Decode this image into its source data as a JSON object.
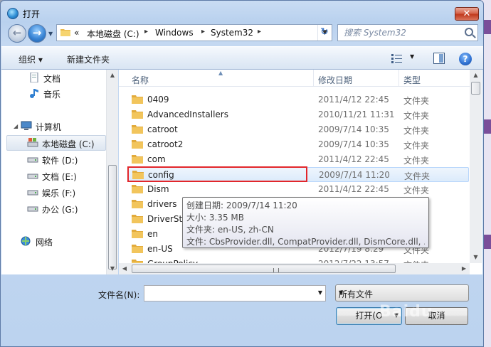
{
  "window": {
    "title": "打开",
    "close_label": "✕"
  },
  "address": {
    "overflow": "«",
    "segments": [
      "本地磁盘 (C:)",
      "Windows",
      "System32"
    ],
    "separator": "▸"
  },
  "search": {
    "placeholder": "搜索 System32"
  },
  "toolbar": {
    "organize_label": "组织 ▾",
    "new_folder_label": "新建文件夹",
    "help_label": "?"
  },
  "sidebar": {
    "items": [
      {
        "label": "文档",
        "icon": "document-icon"
      },
      {
        "label": "音乐",
        "icon": "music-icon"
      },
      {
        "label": "计算机",
        "icon": "computer-icon"
      },
      {
        "label": "本地磁盘 (C:)",
        "icon": "drive-icon"
      },
      {
        "label": "软件 (D:)",
        "icon": "drive-icon"
      },
      {
        "label": "文档 (E:)",
        "icon": "drive-icon"
      },
      {
        "label": "娱乐 (F:)",
        "icon": "drive-icon"
      },
      {
        "label": "办公 (G:)",
        "icon": "drive-icon"
      },
      {
        "label": "网络",
        "icon": "network-icon"
      }
    ]
  },
  "file_list": {
    "columns": [
      "名称",
      "修改日期",
      "类型"
    ],
    "rows": [
      {
        "name": "0409",
        "date": "2011/4/12 22:45",
        "type": "文件夹"
      },
      {
        "name": "AdvancedInstallers",
        "date": "2010/11/21 11:31",
        "type": "文件夹"
      },
      {
        "name": "catroot",
        "date": "2009/7/14 10:35",
        "type": "文件夹"
      },
      {
        "name": "catroot2",
        "date": "2009/7/14 10:35",
        "type": "文件夹"
      },
      {
        "name": "com",
        "date": "2011/4/12 22:45",
        "type": "文件夹"
      },
      {
        "name": "config",
        "date": "2009/7/14 11:20",
        "type": "文件夹"
      },
      {
        "name": "Dism",
        "date": "2011/4/12 22:45",
        "type": "文件夹"
      },
      {
        "name": "drivers",
        "date": "",
        "type": ""
      },
      {
        "name": "DriverSto",
        "date": "",
        "type": ""
      },
      {
        "name": "en",
        "date": "",
        "type": ""
      },
      {
        "name": "en-US",
        "date": "2012/7/19 8:29",
        "type": "文件夹"
      },
      {
        "name": "GroupPolicy",
        "date": "2012/7/22 13:57",
        "type": "文件夹"
      }
    ]
  },
  "tooltip": {
    "lines": [
      "创建日期: 2009/7/14 11:20",
      "大小: 3.35 MB",
      "文件夹: en-US, zh-CN",
      "文件: CbsProvider.dll, CompatProvider.dll, DismCore.dll, ..."
    ]
  },
  "footer": {
    "filename_label": "文件名(N):",
    "filename_value": "",
    "filter_value": "所有文件",
    "open_label": "打开(O",
    "cancel_label": "取消"
  },
  "watermark": "Baidu",
  "colors": {
    "highlight_border": "#e2262b",
    "folder": "#f2c55c",
    "accent": "#3c7fb1"
  }
}
